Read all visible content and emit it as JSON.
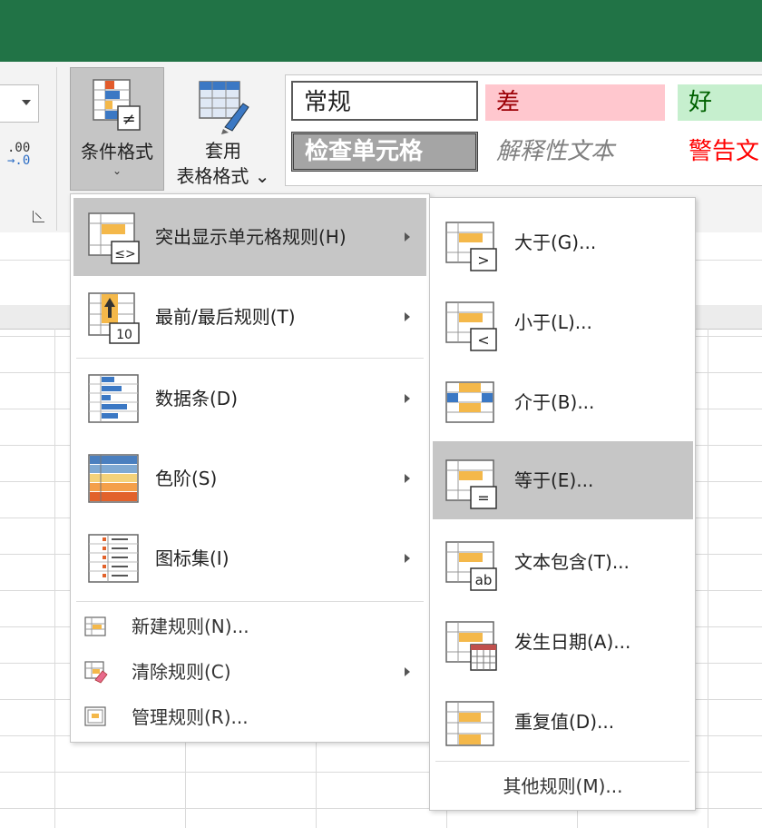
{
  "ribbon": {
    "conditional_format": {
      "label": "条件格式",
      "caret": "⌄"
    },
    "table_format": {
      "label_line1": "套用",
      "label_line2": "表格格式 ⌄"
    },
    "decimal_icon_text": ".00",
    "decimal_icon_text2": "→.0"
  },
  "styles": {
    "normal": "常规",
    "bad": "差",
    "good": "好",
    "check_cell": "检查单元格",
    "explanatory": "解释性文本",
    "warning": "警告文"
  },
  "menu": {
    "items": [
      {
        "label": "突出显示单元格规则(H)"
      },
      {
        "label": "最前/最后规则(T)"
      },
      {
        "label": "数据条(D)"
      },
      {
        "label": "色阶(S)"
      },
      {
        "label": "图标集(I)"
      }
    ],
    "small_items": [
      {
        "label": "新建规则(N)..."
      },
      {
        "label": "清除规则(C)"
      },
      {
        "label": "管理规则(R)..."
      }
    ]
  },
  "submenu": {
    "items": [
      {
        "label": "大于(G)...",
        "badge": ">"
      },
      {
        "label": "小于(L)...",
        "badge": "<"
      },
      {
        "label": "介于(B)..."
      },
      {
        "label": "等于(E)...",
        "badge": "="
      },
      {
        "label": "文本包含(T)...",
        "badge": "ab"
      },
      {
        "label": "发生日期(A)..."
      },
      {
        "label": "重复值(D)..."
      }
    ],
    "more": "其他规则(M)...",
    "top10_badge": "10"
  },
  "colors": {
    "excel_green": "#217346",
    "highlight": "#c6c6c6",
    "icon_orange": "#f4b84a",
    "icon_blue": "#3b78c4"
  }
}
